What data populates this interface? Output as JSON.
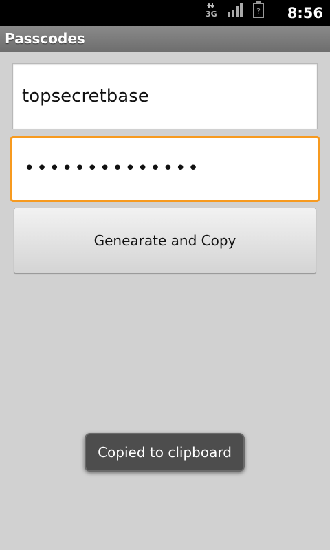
{
  "status_bar": {
    "time": "8:56",
    "network_label": "3G",
    "icons": [
      "data-arrows-icon",
      "signal-bars-icon",
      "battery-unknown-icon"
    ]
  },
  "app": {
    "title": "Passcodes"
  },
  "form": {
    "name_value": "topsecretbase",
    "password_mask": "••••••••••••••",
    "button_label": "Genearate and Copy"
  },
  "toast": {
    "message": "Copied to clipboard"
  },
  "colors": {
    "focus_border": "#f79a1f",
    "background": "#d1d1d1"
  }
}
